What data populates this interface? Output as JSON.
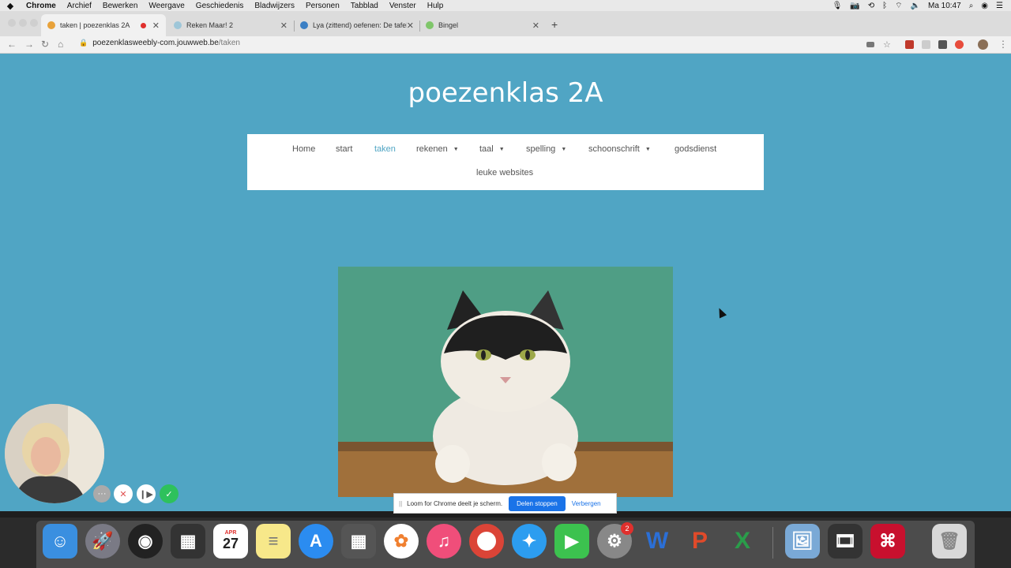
{
  "menubar": {
    "app": "Chrome",
    "items": [
      "Archief",
      "Bewerken",
      "Weergave",
      "Geschiedenis",
      "Bladwijzers",
      "Personen",
      "Tabblad",
      "Venster",
      "Hulp"
    ],
    "clock": "Ma 10:47"
  },
  "tabs": [
    {
      "title": "taken | poezenklas 2A",
      "favicon_color": "#e8a23a"
    },
    {
      "title": "Reken Maar! 2",
      "favicon_color": "#9ec6d8"
    },
    {
      "title": "Lya (zittend) oefenen: De tafel",
      "favicon_color": "#3b7fc4"
    },
    {
      "title": "Bingel",
      "favicon_color": "#7fc66a"
    }
  ],
  "address": {
    "host": "poezenklasweebly-com.jouwweb.be",
    "path": "/taken"
  },
  "site": {
    "title": "poezenklas 2A",
    "nav": [
      "Home",
      "start",
      "taken",
      "rekenen",
      "taal",
      "spelling",
      "schoonschrift",
      "godsdienst",
      "leuke websites"
    ],
    "active_nav": "taken",
    "hero_image": "cat-photo"
  },
  "loom": {
    "message": "Loom for Chrome deelt je scherm.",
    "stop_label": "Delen stoppen",
    "hide_label": "Verbergen"
  },
  "dock": {
    "calendar_month": "APR",
    "calendar_day": "27",
    "sysprefs_badge": "2"
  },
  "colors": {
    "page_bg": "#50a5c4",
    "nav_active": "#50a5c4",
    "loom_button": "#1a73e8"
  }
}
